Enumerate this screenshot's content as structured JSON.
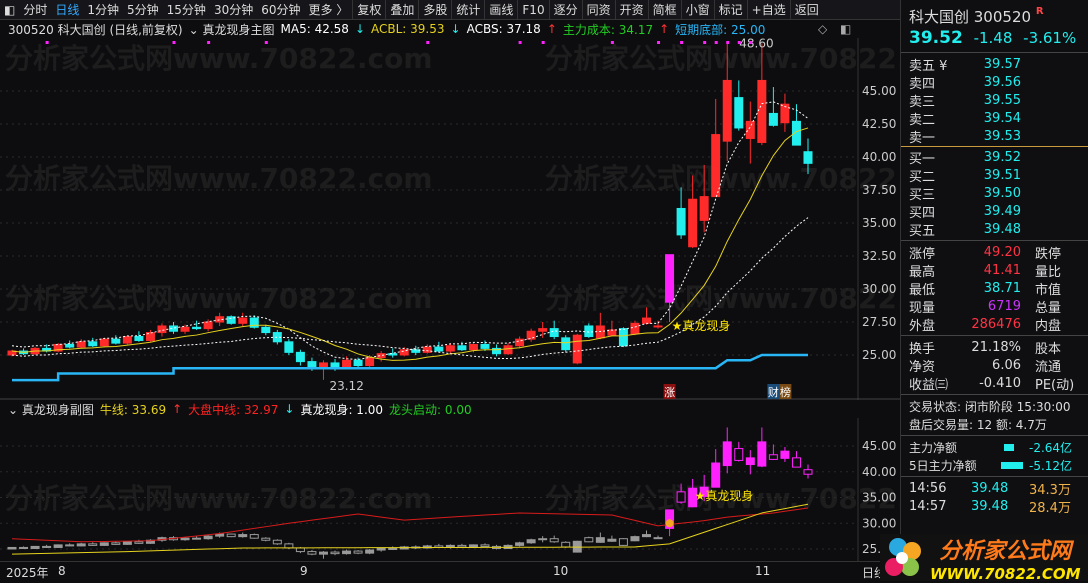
{
  "toolbar": {
    "items": [
      "分时",
      "日线",
      "1分钟",
      "5分钟",
      "15分钟",
      "30分钟",
      "60分钟",
      "更多 〉",
      "复权",
      "叠加",
      "多股",
      "统计",
      "画线",
      "F10",
      "逐分",
      "同资",
      "开资",
      "简框",
      "小窗",
      "标记",
      "+自选",
      "返回"
    ],
    "active": "日线"
  },
  "info": {
    "code_name": "300520 科大国创 (日线,前复权)",
    "indicator": "真龙现身主图",
    "ma5": "MA5: 42.58",
    "acbl": "ACBL: 39.53",
    "acbs": "ACBS: 37.18",
    "cost": "主力成本: 34.17",
    "bottom": "短期底部: 25.00"
  },
  "main_chart": {
    "y_ticks": [
      "45.00",
      "42.50",
      "40.00",
      "37.50",
      "35.00",
      "32.50",
      "30.00",
      "27.50",
      "25.00"
    ],
    "y_values": [
      45,
      42.5,
      40,
      37.5,
      35,
      32.5,
      30,
      27.5,
      25
    ],
    "high_label": "48.60",
    "low_label": "23.12",
    "signal_label": "★真龙现身",
    "badge_zhang": "涨",
    "badge_cai": "财",
    "badge_bang": "榜",
    "colors": {
      "up": "#ff2a2a",
      "down": "#22eeee",
      "signal": "#ff22ff",
      "ma": "#ffffff",
      "mid": "#e6d21e",
      "bottom": "#29b6f6"
    },
    "signal_index": 57,
    "ohlc": [
      [
        25.0,
        25.4,
        24.9,
        25.3
      ],
      [
        25.3,
        25.5,
        25.0,
        25.1
      ],
      [
        25.1,
        25.6,
        25.0,
        25.5
      ],
      [
        25.5,
        25.8,
        25.2,
        25.3
      ],
      [
        25.3,
        25.9,
        25.2,
        25.8
      ],
      [
        25.8,
        26.1,
        25.5,
        25.6
      ],
      [
        25.6,
        26.2,
        25.5,
        26.0
      ],
      [
        26.0,
        26.3,
        25.6,
        25.7
      ],
      [
        25.7,
        26.3,
        25.6,
        26.2
      ],
      [
        26.2,
        26.5,
        25.8,
        25.9
      ],
      [
        25.9,
        26.5,
        25.8,
        26.4
      ],
      [
        26.4,
        26.8,
        26.0,
        26.1
      ],
      [
        26.1,
        26.9,
        26.0,
        26.7
      ],
      [
        26.7,
        27.4,
        26.4,
        27.2
      ],
      [
        27.2,
        27.5,
        26.6,
        26.8
      ],
      [
        26.8,
        27.3,
        26.6,
        27.1
      ],
      [
        27.1,
        27.6,
        26.9,
        27.0
      ],
      [
        27.0,
        27.7,
        26.8,
        27.5
      ],
      [
        27.5,
        28.2,
        27.2,
        27.9
      ],
      [
        27.9,
        28.0,
        27.3,
        27.4
      ],
      [
        27.4,
        28.2,
        27.2,
        27.8
      ],
      [
        27.8,
        28.0,
        27.0,
        27.1
      ],
      [
        27.1,
        27.3,
        26.5,
        26.7
      ],
      [
        26.7,
        26.9,
        25.8,
        26.0
      ],
      [
        26.0,
        26.2,
        25.0,
        25.2
      ],
      [
        25.2,
        25.4,
        24.2,
        24.5
      ],
      [
        24.5,
        24.8,
        23.8,
        24.0
      ],
      [
        24.0,
        24.6,
        23.12,
        24.4
      ],
      [
        24.4,
        24.7,
        23.8,
        24.1
      ],
      [
        24.1,
        24.9,
        23.9,
        24.6
      ],
      [
        24.6,
        24.8,
        24.0,
        24.2
      ],
      [
        24.2,
        25.0,
        24.0,
        24.8
      ],
      [
        24.8,
        25.3,
        24.5,
        25.1
      ],
      [
        25.1,
        25.5,
        24.8,
        25.0
      ],
      [
        25.0,
        25.6,
        24.9,
        25.4
      ],
      [
        25.4,
        25.7,
        25.0,
        25.2
      ],
      [
        25.2,
        25.8,
        25.1,
        25.6
      ],
      [
        25.6,
        26.0,
        25.2,
        25.3
      ],
      [
        25.3,
        25.9,
        25.1,
        25.7
      ],
      [
        25.7,
        26.0,
        25.3,
        25.4
      ],
      [
        25.4,
        25.9,
        25.2,
        25.8
      ],
      [
        25.8,
        26.1,
        25.3,
        25.5
      ],
      [
        25.5,
        25.8,
        24.9,
        25.1
      ],
      [
        25.1,
        25.9,
        25.0,
        25.7
      ],
      [
        25.7,
        26.4,
        25.5,
        26.2
      ],
      [
        26.2,
        27.0,
        26.0,
        26.8
      ],
      [
        26.8,
        27.5,
        26.3,
        27.0
      ],
      [
        27.0,
        27.6,
        26.2,
        26.4
      ],
      [
        26.3,
        26.5,
        25.2,
        25.4
      ],
      [
        24.4,
        26.6,
        24.3,
        26.5
      ],
      [
        27.2,
        27.4,
        26.3,
        26.4
      ],
      [
        26.3,
        28.2,
        26.2,
        27.2
      ],
      [
        26.5,
        27.6,
        26.4,
        26.9
      ],
      [
        27.0,
        27.1,
        25.6,
        25.7
      ],
      [
        26.6,
        27.6,
        26.5,
        27.4
      ],
      [
        27.4,
        28.6,
        27.3,
        27.8
      ],
      [
        27.2,
        27.6,
        27.0,
        27.2
      ],
      [
        29.0,
        32.6,
        27.5,
        32.6
      ],
      [
        36.1,
        37.7,
        33.8,
        34.1
      ],
      [
        33.2,
        38.6,
        33.1,
        36.8
      ],
      [
        35.2,
        39.4,
        34.3,
        37.0
      ],
      [
        37.0,
        44.4,
        37.0,
        41.7
      ],
      [
        41.2,
        48.6,
        39.7,
        45.8
      ],
      [
        44.5,
        45.8,
        42.0,
        42.2
      ],
      [
        41.4,
        44.2,
        39.5,
        42.7
      ],
      [
        41.1,
        48.6,
        40.9,
        45.8
      ],
      [
        43.3,
        45.3,
        42.3,
        42.4
      ],
      [
        42.6,
        44.8,
        41.9,
        44.0
      ],
      [
        42.7,
        44.0,
        40.9,
        40.9
      ],
      [
        40.4,
        41.4,
        38.7,
        39.52
      ]
    ],
    "short_bottom": [
      [
        0,
        23.1
      ],
      [
        4,
        23.1
      ],
      [
        4,
        23.6
      ],
      [
        14,
        23.6
      ],
      [
        14,
        24.0
      ],
      [
        61,
        24.0
      ],
      [
        62,
        24.6
      ],
      [
        64,
        24.6
      ],
      [
        65,
        25.0
      ],
      [
        69,
        25.0
      ]
    ]
  },
  "sub_chart": {
    "title": "真龙现身副图",
    "bull": "牛线: 33.69",
    "market_mid": "大盘中线: 32.97",
    "dragon": "真龙现身: 1.00",
    "leader": "龙头启动: 0.00",
    "y_ticks": [
      "45.00",
      "40.00",
      "35.00",
      "30.00",
      "25.00"
    ],
    "y_values": [
      45,
      40,
      35,
      30,
      25
    ],
    "signal_label": "★真龙现身",
    "mid_line": [
      [
        0,
        27.0
      ],
      [
        6,
        26.4
      ],
      [
        12,
        26.6
      ],
      [
        18,
        28.0
      ],
      [
        24,
        30.0
      ],
      [
        30,
        31.8
      ],
      [
        34,
        30.6
      ],
      [
        38,
        31.2
      ],
      [
        44,
        32.0
      ],
      [
        52,
        31.6
      ],
      [
        56,
        29.5
      ],
      [
        60,
        30.5
      ],
      [
        62,
        31.2
      ],
      [
        66,
        32.0
      ],
      [
        69,
        32.97
      ]
    ],
    "bull_line": [
      [
        0,
        24.0
      ],
      [
        10,
        24.5
      ],
      [
        20,
        25.2
      ],
      [
        40,
        25.3
      ],
      [
        54,
        25.4
      ],
      [
        57,
        26.0
      ],
      [
        61,
        29.0
      ],
      [
        65,
        32.0
      ],
      [
        69,
        33.69
      ]
    ]
  },
  "dates": [
    "2025年",
    "8",
    "9",
    "10",
    "11",
    "日线"
  ],
  "quote": {
    "name_code": "科大国创 300520",
    "r": "R",
    "price": "39.52",
    "change": "-1.48",
    "pct": "-3.61%",
    "asks": [
      {
        "label": "卖五 ¥",
        "price": "39.57"
      },
      {
        "label": "卖四",
        "price": "39.56"
      },
      {
        "label": "卖三",
        "price": "39.55"
      },
      {
        "label": "卖二",
        "price": "39.54"
      },
      {
        "label": "卖一",
        "price": "39.53"
      }
    ],
    "bids": [
      {
        "label": "买一",
        "price": "39.52"
      },
      {
        "label": "买二",
        "price": "39.51"
      },
      {
        "label": "买三",
        "price": "39.50"
      },
      {
        "label": "买四",
        "price": "39.49"
      },
      {
        "label": "买五",
        "price": "39.48"
      }
    ],
    "stats": [
      {
        "l": "涨停",
        "v": "49.20",
        "c": "#ff3344",
        "r": "跌停"
      },
      {
        "l": "最高",
        "v": "41.41",
        "c": "#ff3344",
        "r": "量比"
      },
      {
        "l": "最低",
        "v": "38.71",
        "c": "#22eeee",
        "r": "市值"
      },
      {
        "l": "现量",
        "v": "6719",
        "c": "#cc33ff",
        "r": "总量"
      },
      {
        "l": "外盘",
        "v": "286476",
        "c": "#ff3344",
        "r": "内盘"
      }
    ],
    "stats2": [
      {
        "l": "换手",
        "v": "21.18%",
        "r": "股本"
      },
      {
        "l": "净资",
        "v": "6.06",
        "r": "流通"
      },
      {
        "l": "收益㈢",
        "v": "-0.410",
        "r": "PE(动)"
      }
    ],
    "status": "交易状态: 闭市阶段 15:30:00",
    "after": "盘后交易量: 12  额: 4.7万",
    "flow": [
      {
        "l": "主力净额",
        "v": "-2.64亿"
      },
      {
        "l": "5日主力净额",
        "v": "-5.12亿"
      }
    ],
    "ticks": [
      {
        "t": "14:56",
        "p": "39.48",
        "v": "34.3万"
      },
      {
        "t": "14:57",
        "p": "39.48",
        "v": "28.4万"
      }
    ],
    "logo_cn": "分析家公式网",
    "logo_url": "WWW.70822.COM"
  },
  "watermark": "分析家公式网www.70822.com"
}
